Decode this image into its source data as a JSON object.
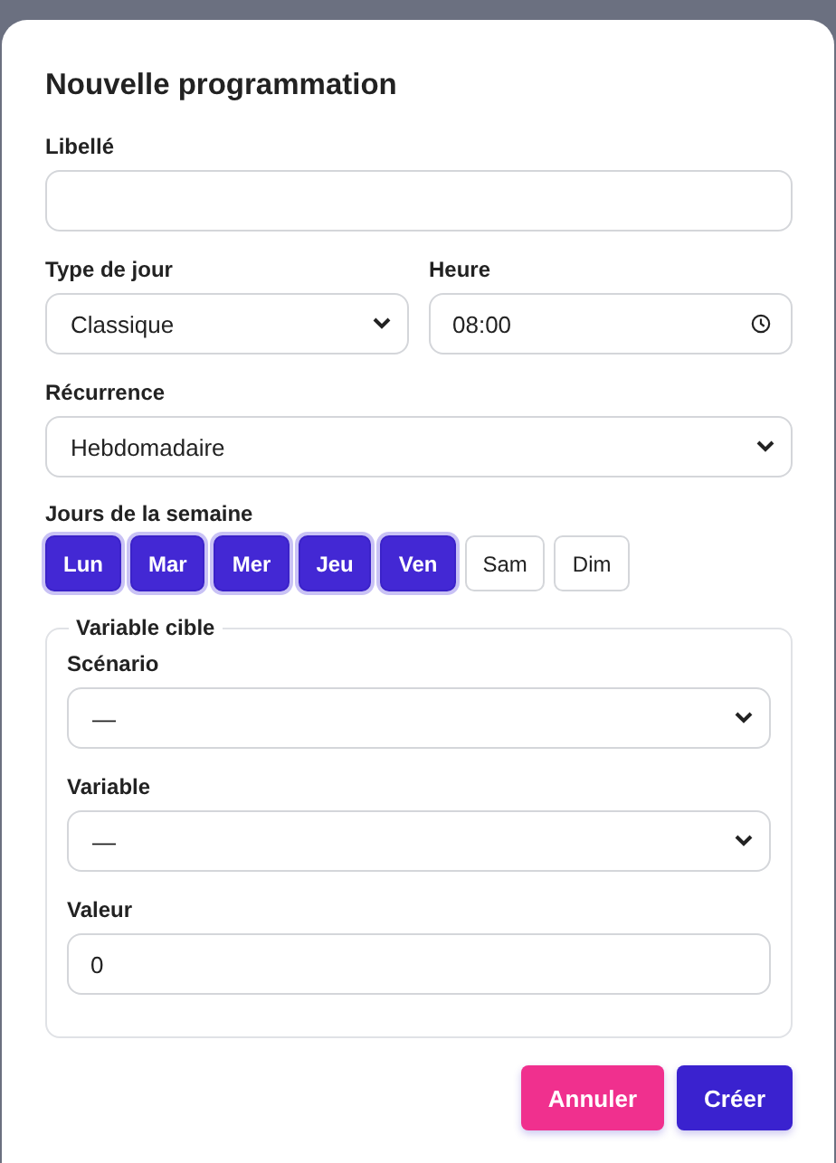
{
  "dialog": {
    "title": "Nouvelle programmation"
  },
  "label_field": {
    "label": "Libellé"
  },
  "day_type": {
    "label": "Type de jour",
    "value": "Classique"
  },
  "time": {
    "label": "Heure",
    "value": "08:00"
  },
  "recurrence": {
    "label": "Récurrence",
    "value": "Hebdomadaire"
  },
  "weekdays": {
    "label": "Jours de la semaine",
    "days": [
      {
        "label": "Lun",
        "selected": true
      },
      {
        "label": "Mar",
        "selected": true
      },
      {
        "label": "Mer",
        "selected": true
      },
      {
        "label": "Jeu",
        "selected": true
      },
      {
        "label": "Ven",
        "selected": true
      },
      {
        "label": "Sam",
        "selected": false
      },
      {
        "label": "Dim",
        "selected": false
      }
    ]
  },
  "target": {
    "legend": "Variable cible",
    "fields": [
      {
        "kind": "select",
        "label": "Scénario",
        "value": "—"
      },
      {
        "kind": "select",
        "label": "Variable",
        "value": "—"
      },
      {
        "kind": "input",
        "label": "Valeur",
        "value": "0"
      }
    ]
  },
  "buttons": [
    {
      "kind": "cancel",
      "label": "Annuler"
    },
    {
      "kind": "primary",
      "label": "Créer"
    }
  ]
}
